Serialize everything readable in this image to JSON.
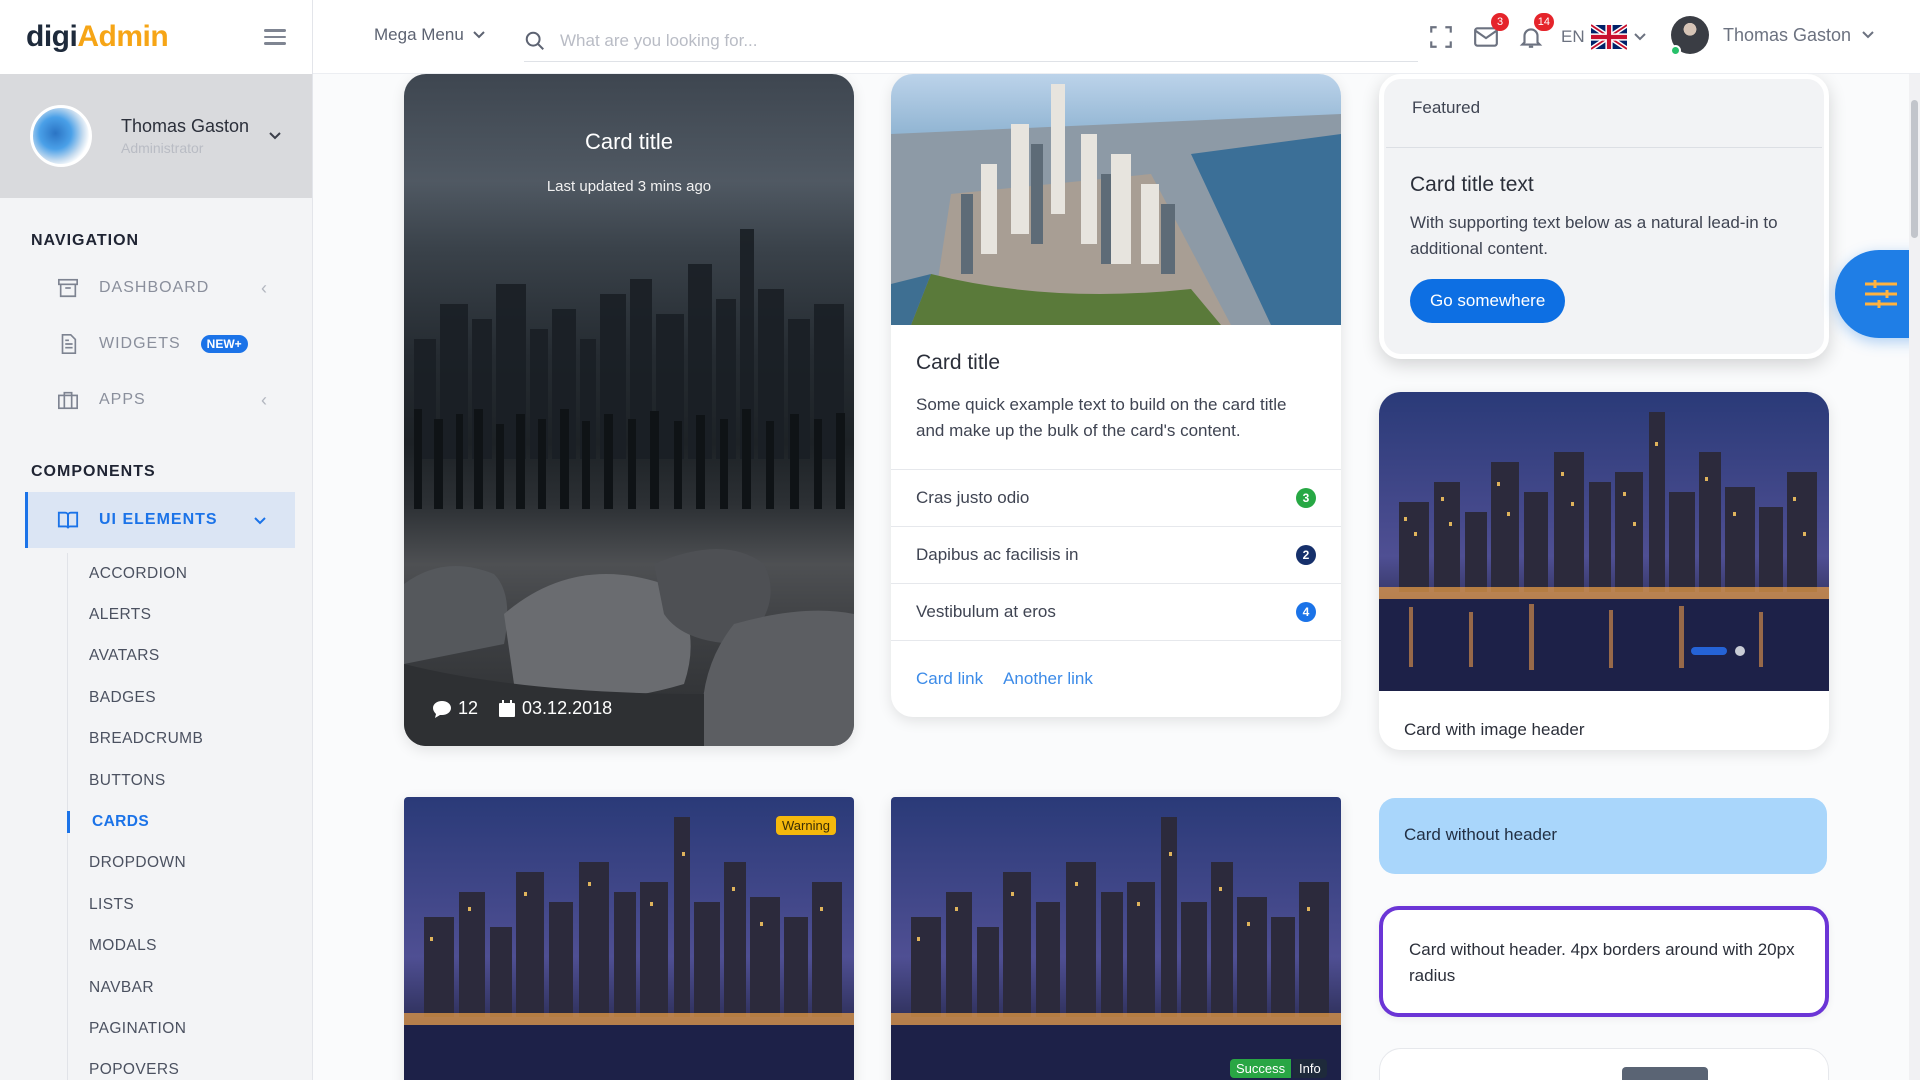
{
  "brand": {
    "part1": "digi",
    "part2": "Admin",
    "color_dark": "#1e2a3b",
    "color_accent": "#f6a516"
  },
  "sidebar": {
    "user": {
      "name": "Thomas Gaston",
      "role": "Administrator"
    },
    "navigation_heading": "NAVIGATION",
    "nav_items": [
      {
        "label": "DASHBOARD",
        "icon": "archive-box-icon"
      },
      {
        "label": "WIDGETS",
        "icon": "document-icon",
        "badge": "NEW+"
      },
      {
        "label": "APPS",
        "icon": "briefcase-icon"
      }
    ],
    "components_heading": "COMPONENTS",
    "ui_elements": {
      "label": "UI ELEMENTS",
      "icon": "book-open-icon"
    },
    "sub_items": [
      "ACCORDION",
      "ALERTS",
      "AVATARS",
      "BADGES",
      "BREADCRUMB",
      "BUTTONS",
      "CARDS",
      "DROPDOWN",
      "LISTS",
      "MODALS",
      "NAVBAR",
      "PAGINATION",
      "POPOVERS"
    ],
    "active_sub_item": "CARDS"
  },
  "header": {
    "mega_menu": "Mega Menu",
    "search_placeholder": "What are you looking for...",
    "mail_count": "3",
    "notification_count": "14",
    "language": "EN",
    "user_name": "Thomas Gaston"
  },
  "cards": {
    "overlay": {
      "title": "Card title",
      "subtitle": "Last updated 3 mins ago",
      "comments": "12",
      "date": "03.12.2018"
    },
    "list_card": {
      "title": "Card title",
      "text": "Some quick example text to build on the card title and make up the bulk of the card's content.",
      "items": [
        {
          "label": "Cras justo odio",
          "count": "3",
          "color": "#27a844"
        },
        {
          "label": "Dapibus ac facilisis in",
          "count": "2",
          "color": "#16306b"
        },
        {
          "label": "Vestibulum at eros",
          "count": "4",
          "color": "#1b73e8"
        }
      ],
      "link1": "Card link",
      "link2": "Another link"
    },
    "featured": {
      "header": "Featured",
      "title": "Card title text",
      "text": "With supporting text below as a natural lead-in to additional content.",
      "button": "Go somewhere"
    },
    "image_header": {
      "footer": "Card with image header"
    },
    "no_header": {
      "text": "Card without header"
    },
    "bordered": {
      "text": "Card without header. 4px borders around with 20px radius"
    },
    "tags": {
      "warning": "Warning",
      "success": "Success",
      "info": "Info"
    }
  },
  "colors": {
    "primary": "#1b73e8",
    "badge_red": "#e5242b",
    "online_green": "#27c16a",
    "border_purple": "#6b35d6",
    "light_blue": "#a9d6fb"
  }
}
